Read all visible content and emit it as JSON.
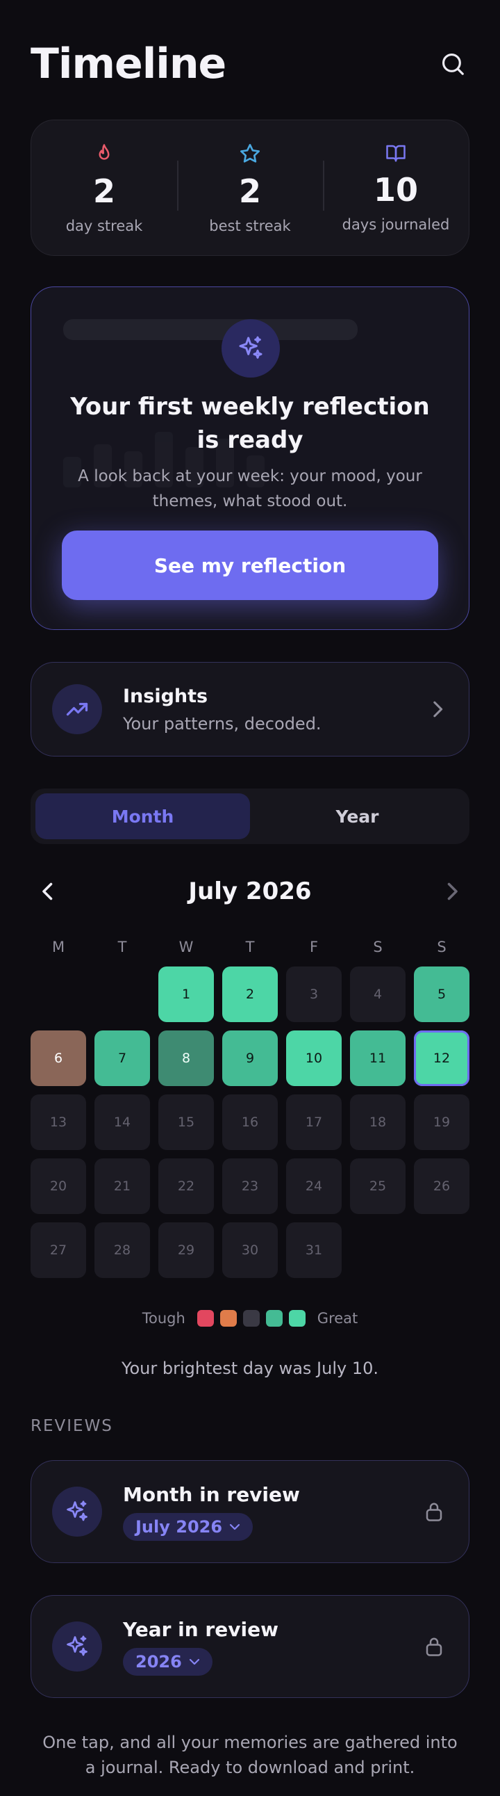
{
  "header": {
    "title": "Timeline",
    "search_icon": "search-icon"
  },
  "stats": [
    {
      "icon": "flame-icon",
      "color": "#ea5b6b",
      "value": "2",
      "label": "day streak"
    },
    {
      "icon": "star-icon",
      "color": "#4aa8e0",
      "value": "2",
      "label": "best streak"
    },
    {
      "icon": "book-icon",
      "color": "#7a78f2",
      "value": "10",
      "label": "days journaled"
    }
  ],
  "reflection": {
    "icon": "sparkles-icon",
    "title": "Your first weekly reflection is ready",
    "subtitle": "A look back at your week: your mood, your themes, what stood out.",
    "button": "See my reflection"
  },
  "insights": {
    "icon": "trend-up-icon",
    "title": "Insights",
    "subtitle": "Your patterns, decoded."
  },
  "view_toggle": {
    "month": "Month",
    "year": "Year",
    "selected": "Month"
  },
  "calendar": {
    "month_label": "July 2026",
    "weekdays": [
      "M",
      "T",
      "W",
      "T",
      "F",
      "S",
      "S"
    ],
    "leading_blanks": 2,
    "days": [
      {
        "d": "1",
        "mood": "great"
      },
      {
        "d": "2",
        "mood": "great"
      },
      {
        "d": "3",
        "mood": "none"
      },
      {
        "d": "4",
        "mood": "none"
      },
      {
        "d": "5",
        "mood": "good"
      },
      {
        "d": "6",
        "mood": "tough"
      },
      {
        "d": "7",
        "mood": "good"
      },
      {
        "d": "8",
        "mood": "mid"
      },
      {
        "d": "9",
        "mood": "good"
      },
      {
        "d": "10",
        "mood": "great"
      },
      {
        "d": "11",
        "mood": "good"
      },
      {
        "d": "12",
        "mood": "great",
        "today": true
      },
      {
        "d": "13",
        "mood": "none"
      },
      {
        "d": "14",
        "mood": "none"
      },
      {
        "d": "15",
        "mood": "none"
      },
      {
        "d": "16",
        "mood": "none"
      },
      {
        "d": "17",
        "mood": "none"
      },
      {
        "d": "18",
        "mood": "none"
      },
      {
        "d": "19",
        "mood": "none"
      },
      {
        "d": "20",
        "mood": "none"
      },
      {
        "d": "21",
        "mood": "none"
      },
      {
        "d": "22",
        "mood": "none"
      },
      {
        "d": "23",
        "mood": "none"
      },
      {
        "d": "24",
        "mood": "none"
      },
      {
        "d": "25",
        "mood": "none"
      },
      {
        "d": "26",
        "mood": "none"
      },
      {
        "d": "27",
        "mood": "none"
      },
      {
        "d": "28",
        "mood": "none"
      },
      {
        "d": "29",
        "mood": "none"
      },
      {
        "d": "30",
        "mood": "none"
      },
      {
        "d": "31",
        "mood": "none"
      }
    ]
  },
  "legend": {
    "low": "Tough",
    "high": "Great",
    "colors": [
      "#e2475f",
      "#e07c4a",
      "#3a3944",
      "#44bb94",
      "#4dd6a6"
    ]
  },
  "brightest": "Your brightest day was July 10.",
  "reviews": {
    "heading": "REVIEWS",
    "month": {
      "title": "Month in review",
      "value": "July 2026"
    },
    "year": {
      "title": "Year in review",
      "value": "2026"
    }
  },
  "footer": "One tap, and all your memories are gathered into a journal. Ready to download and print.",
  "colors": {
    "accent": "#6e6cf0",
    "background": "#0d0c11",
    "card": "#16151d"
  }
}
